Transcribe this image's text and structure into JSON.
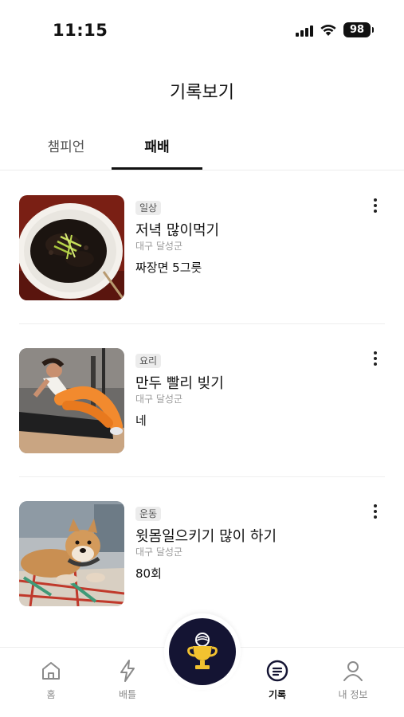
{
  "status_bar": {
    "time": "11:15",
    "battery": "98"
  },
  "header": {
    "title": "기록보기"
  },
  "tabs": [
    {
      "label": "챔피언",
      "active": false
    },
    {
      "label": "패배",
      "active": true
    }
  ],
  "records": [
    {
      "category": "일상",
      "title": "저녁 많이먹기",
      "location": "대구 달성군",
      "detail": "짜장면 5그릇",
      "image": "jajangmyeon-photo"
    },
    {
      "category": "요리",
      "title": "만두 빨리 빚기",
      "location": "대구 달성군",
      "detail": "네",
      "image": "situp-exercise-photo"
    },
    {
      "category": "운동",
      "title": "윗몸일으키기 많이 하기",
      "location": "대구 달성군",
      "detail": "80회",
      "image": "shiba-dog-photo"
    }
  ],
  "bottom_nav": {
    "items": [
      {
        "label": "홈",
        "icon": "home-icon",
        "active": false
      },
      {
        "label": "배틀",
        "icon": "lightning-icon",
        "active": false
      },
      {
        "label": "기록",
        "icon": "records-icon",
        "active": true
      },
      {
        "label": "내 정보",
        "icon": "person-icon",
        "active": false
      }
    ],
    "center_button_icon": "trophy-icon"
  },
  "colors": {
    "accent": "#141433",
    "trophy": "#f2c230",
    "text": "#111111",
    "muted": "#9a9a9a"
  }
}
